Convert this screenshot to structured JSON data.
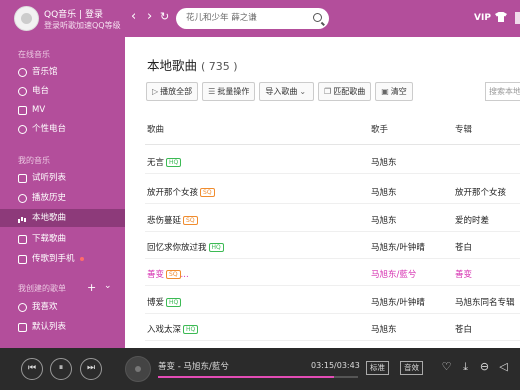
{
  "header": {
    "brand": "QQ音乐",
    "separator": "|",
    "login": "登录",
    "subtitle": "登录听歌加速QQ等级",
    "back": "‹",
    "forward": "›",
    "refresh": "↻",
    "search_text": "花儿和少年  薛之谦",
    "vip": "VIP"
  },
  "sidebar": {
    "sections": [
      {
        "title": "在线音乐"
      },
      {
        "title": "我的音乐"
      },
      {
        "title": "我创建的歌单"
      }
    ],
    "online": [
      {
        "label": "音乐馆",
        "icon": "music-hall-icon"
      },
      {
        "label": "电台",
        "icon": "radio-icon"
      },
      {
        "label": "MV",
        "icon": "mv-icon"
      },
      {
        "label": "个性电台",
        "icon": "personal-radio-icon"
      }
    ],
    "mine": [
      {
        "label": "试听列表",
        "icon": "list-icon"
      },
      {
        "label": "播放历史",
        "icon": "history-icon"
      },
      {
        "label": "本地歌曲",
        "icon": "local-songs-icon",
        "active": true
      },
      {
        "label": "下载歌曲",
        "icon": "download-icon"
      },
      {
        "label": "传歌到手机",
        "icon": "phone-icon"
      }
    ],
    "playlists": [
      {
        "label": "我喜欢",
        "icon": "heart-icon"
      },
      {
        "label": "默认列表",
        "icon": "playlist-icon"
      }
    ],
    "add": "+",
    "collapse": "⌄"
  },
  "main": {
    "title": "本地歌曲",
    "count": "( 735 )",
    "toolbar": {
      "play_all": "播放全部",
      "batch": "批量操作",
      "import": "导入歌曲",
      "match": "匹配歌曲",
      "clear": "清空",
      "filter_placeholder": "搜索本地"
    },
    "columns": {
      "song": "歌曲",
      "artist": "歌手",
      "album": "专辑"
    },
    "rows": [
      {
        "song": "无言",
        "badge": "HQ",
        "artist": "马旭东",
        "album": ""
      },
      {
        "song": "放开那个女孩",
        "badge": "SQ",
        "artist": "马旭东",
        "album": "放开那个女孩"
      },
      {
        "song": "悲伤蔓延",
        "badge": "SQ",
        "artist": "马旭东",
        "album": "爱的时差"
      },
      {
        "song": "回忆求你放过我",
        "badge": "HQ",
        "artist": "马旭东/叶钟晴",
        "album": "苍白"
      },
      {
        "song": "善变",
        "badge": "SQ",
        "extra": "...",
        "artist": "马旭东/藍兮",
        "album": "善变",
        "playing": true
      },
      {
        "song": "博爱",
        "badge": "HQ",
        "artist": "马旭东/叶钟晴",
        "album": "马旭东同名专辑"
      },
      {
        "song": "入戏太深",
        "badge": "HQ",
        "artist": "马旭东",
        "album": "苍白"
      }
    ]
  },
  "player": {
    "now_playing": "善变 - 马旭东/藍兮",
    "time": "03:15/03:43",
    "progress": 0.88,
    "quality": "标准",
    "sound": "音效",
    "prev": "⏮",
    "pause": "⏸",
    "next": "⏭",
    "colors": {
      "accent": "#e34cb5",
      "theme": "#b34e9b"
    }
  }
}
